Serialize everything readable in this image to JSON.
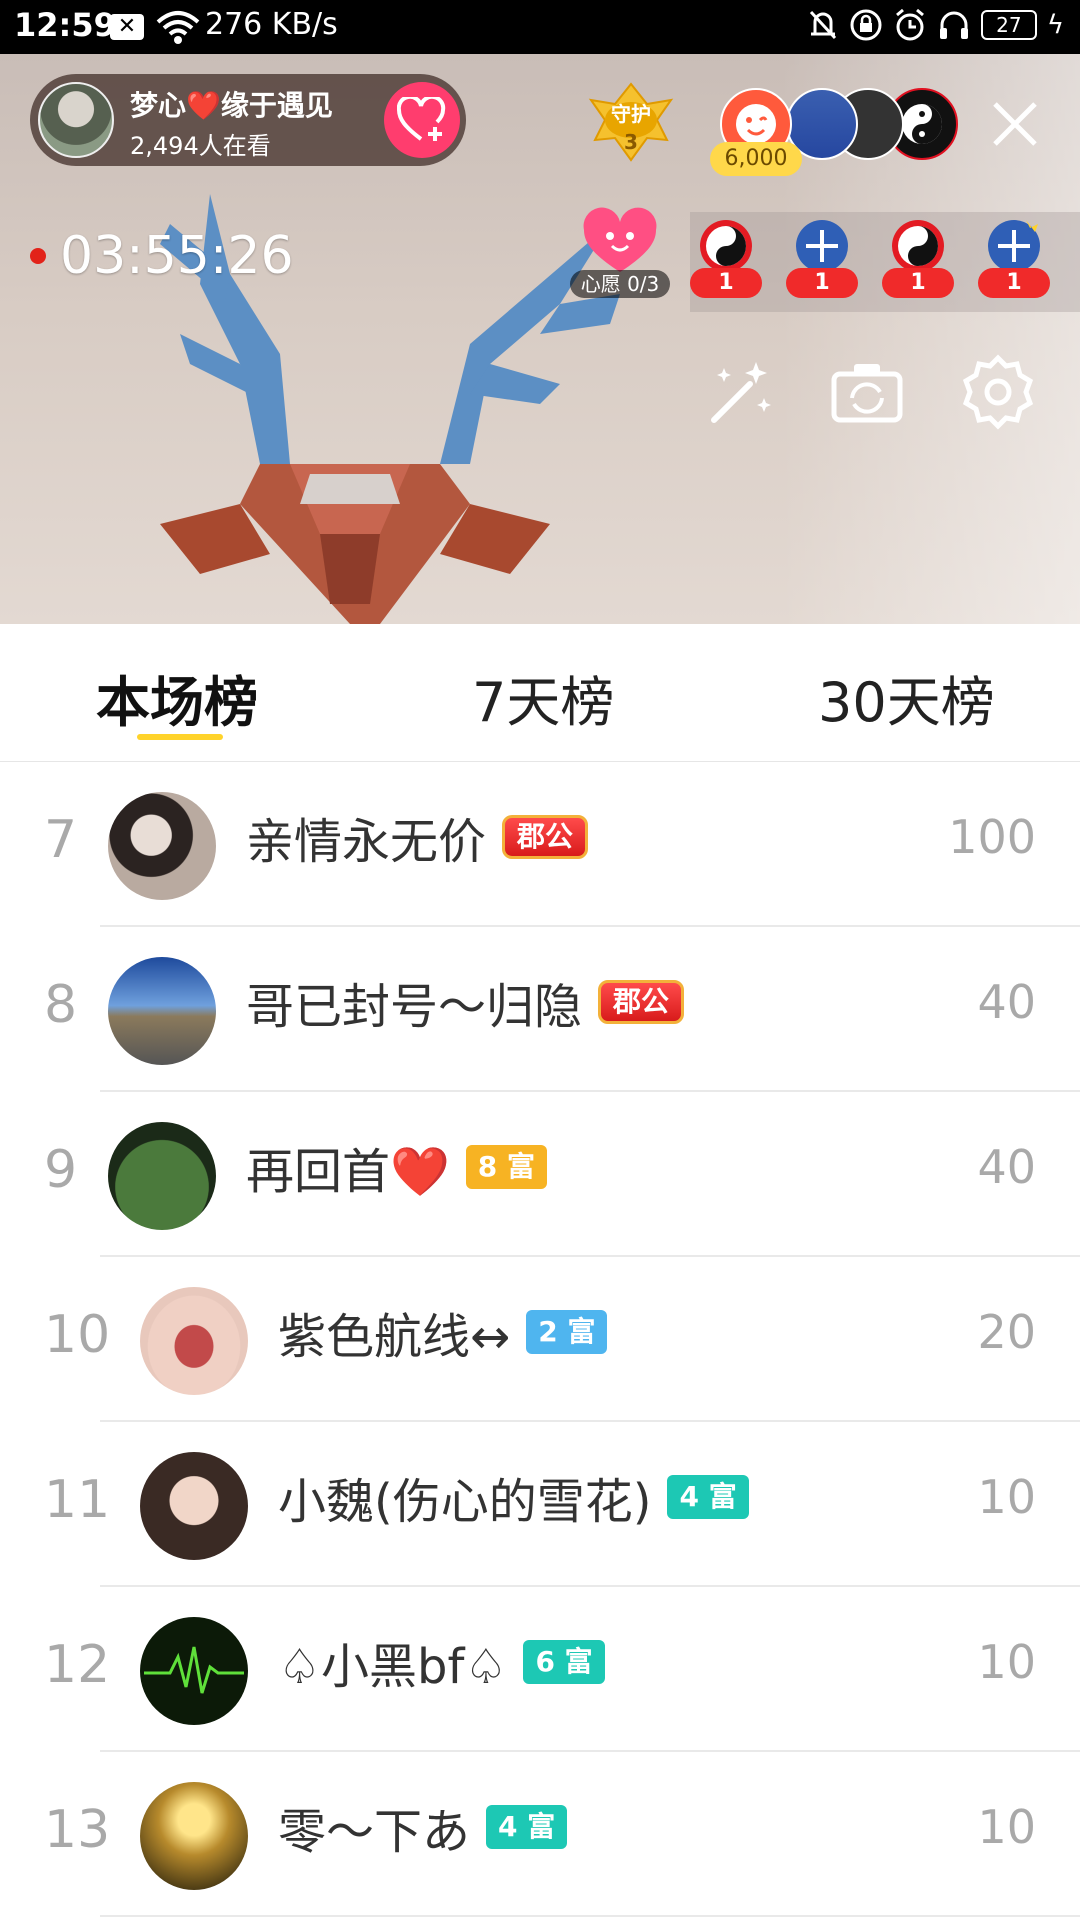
{
  "status_bar": {
    "time": "12:59",
    "network_speed": "276 KB/s",
    "battery": "27",
    "notification_icon": "x-box-icon"
  },
  "live": {
    "host_name": "梦心❤️缘于遇见",
    "viewer_count": "2,494人在看",
    "guard_label": "守护",
    "guard_count": "3",
    "coin_amount": "6,000",
    "live_timer": "03:55:26",
    "wish_label": "心愿 0/3",
    "gift_counts": [
      "1",
      "1",
      "1",
      "1"
    ]
  },
  "tabs": [
    "本场榜",
    "7天榜",
    "30天榜"
  ],
  "ranking": [
    {
      "rank": "7",
      "name": "亲情永无价",
      "badge": "郡公",
      "badge_type": "jun",
      "score": "100"
    },
    {
      "rank": "8",
      "name": "哥已封号～归隐",
      "badge": "郡公",
      "badge_type": "jun",
      "score": "40"
    },
    {
      "rank": "9",
      "name": "再回首❤️",
      "badge": "8 富",
      "badge_type": "gold",
      "score": "40"
    },
    {
      "rank": "10",
      "name": "紫色航线↔",
      "badge": "2 富",
      "badge_type": "blue",
      "score": "20"
    },
    {
      "rank": "11",
      "name": "小魏(伤心的雪花)",
      "badge": "4 富",
      "badge_type": "teal",
      "score": "10"
    },
    {
      "rank": "12",
      "name": "♤小黑bf♤",
      "badge": "6 富",
      "badge_type": "teal",
      "score": "10"
    },
    {
      "rank": "13",
      "name": "零～下あ",
      "badge": "4 富",
      "badge_type": "teal",
      "score": "10"
    }
  ],
  "colors": {
    "accent_yellow": "#ffd32a",
    "follow_pink": "#ff3d6e",
    "record_red": "#e2231a",
    "rank_grey": "#a9a9a9"
  }
}
